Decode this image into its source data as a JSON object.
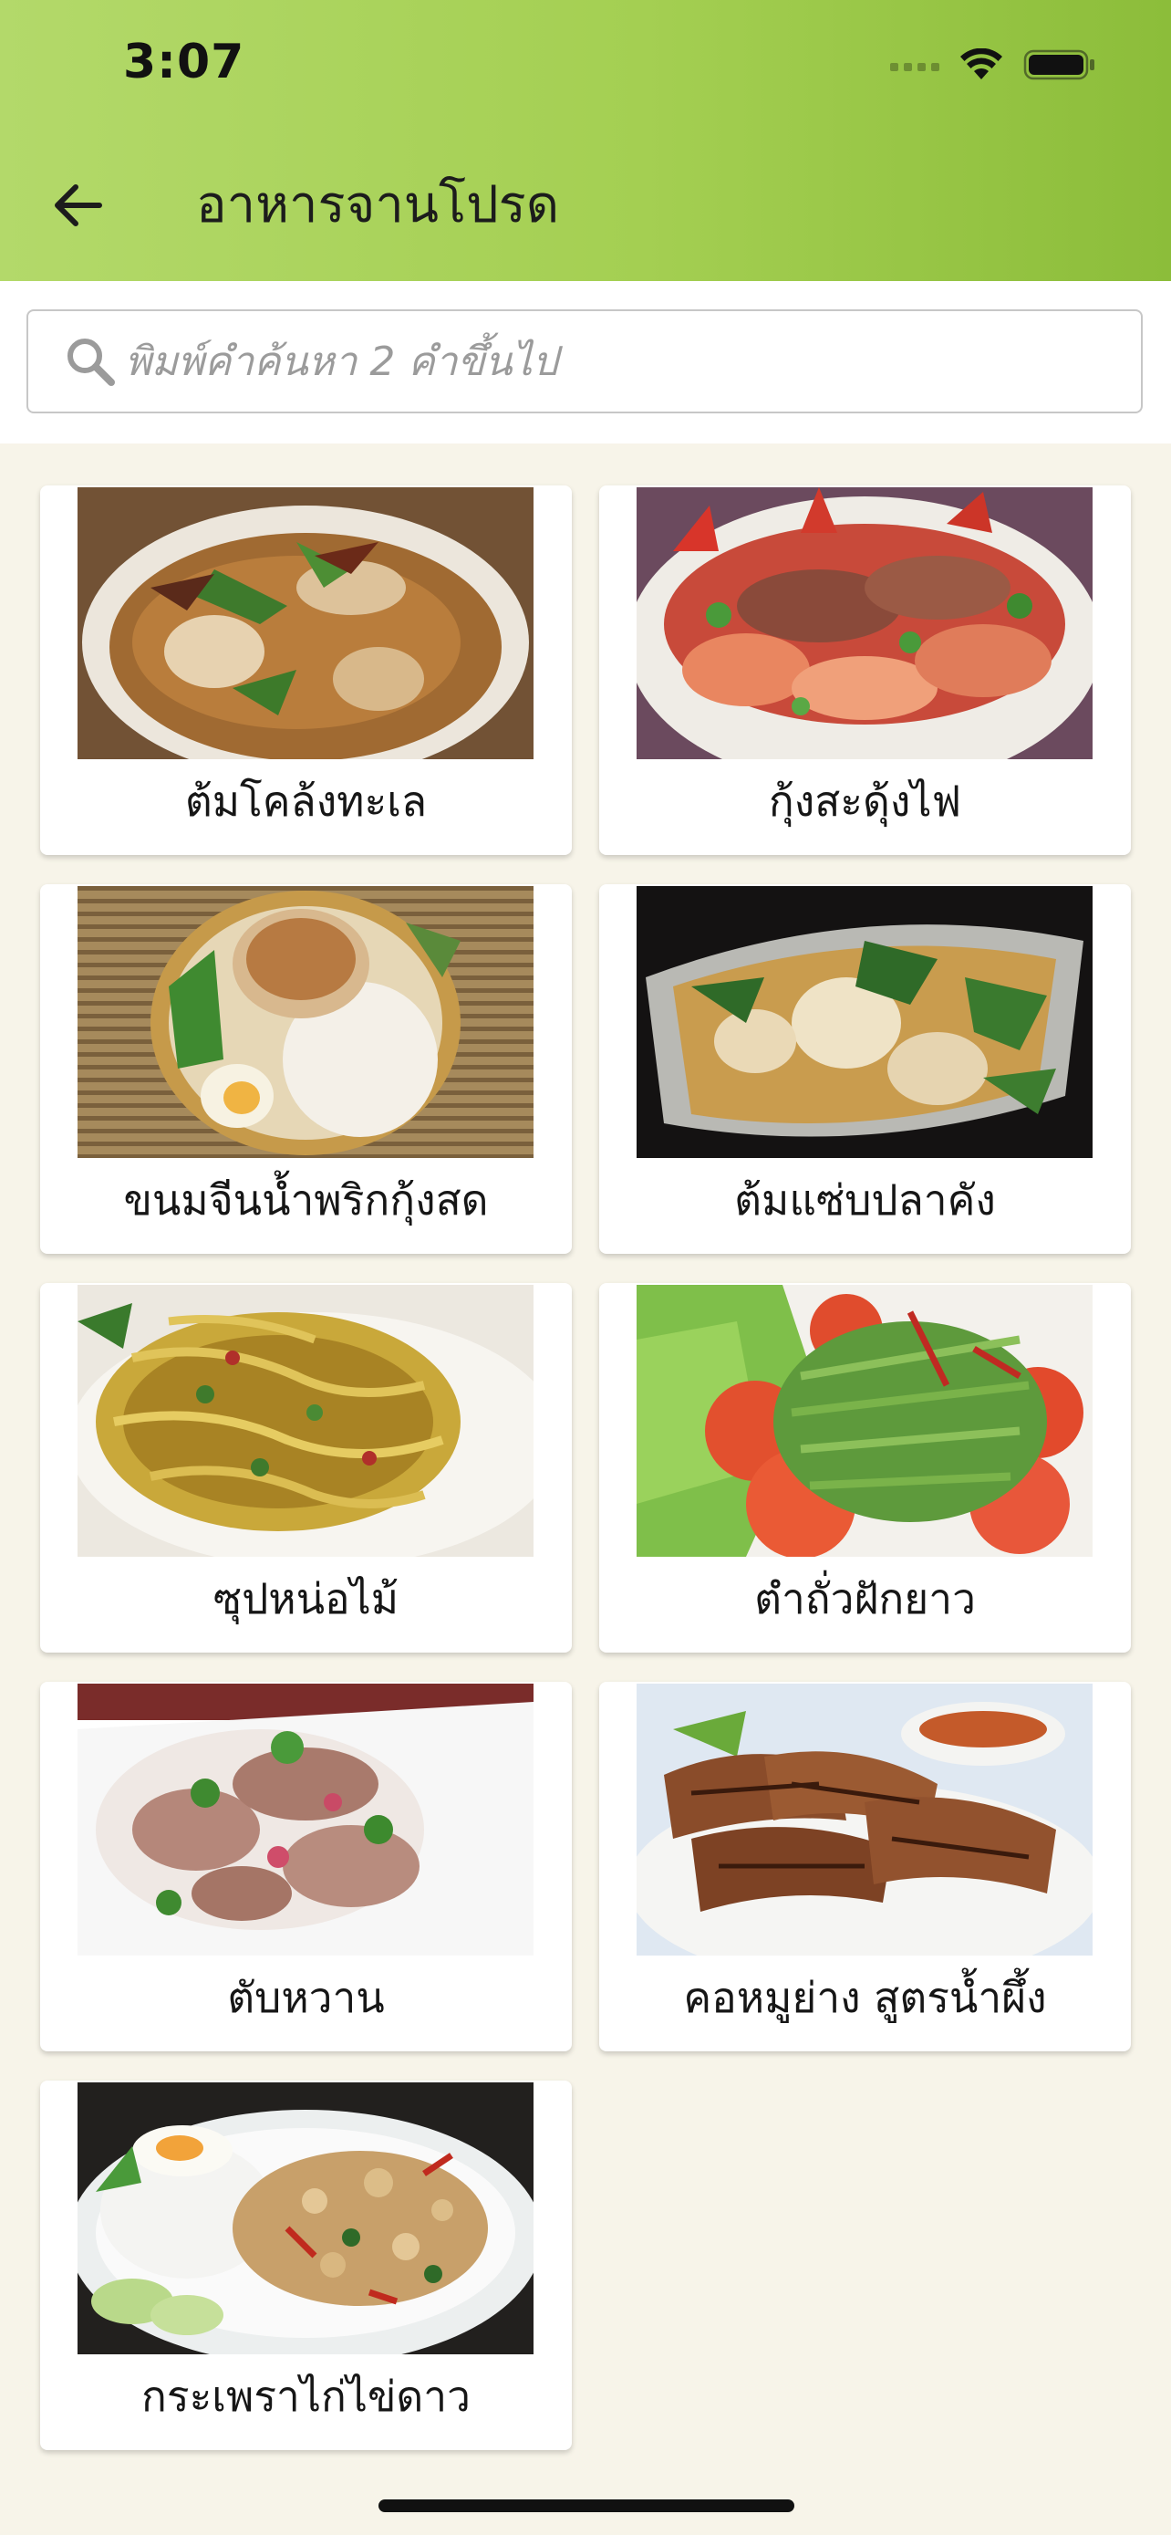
{
  "status_bar": {
    "time": "3:07"
  },
  "header": {
    "title": "อาหารจานโปรด",
    "back_icon": "arrow-left-icon"
  },
  "search": {
    "placeholder": "พิมพ์คำค้นหา 2 คำขึ้นไป",
    "icon": "search-icon"
  },
  "dishes": [
    {
      "name": "ต้มโคล้งทะเล"
    },
    {
      "name": "กุ้งสะดุ้งไฟ"
    },
    {
      "name": "ขนมจีนน้ำพริกกุ้งสด"
    },
    {
      "name": "ต้มแซ่บปลาคัง"
    },
    {
      "name": "ซุปหน่อไม้"
    },
    {
      "name": "ตำถั่วฝักยาว"
    },
    {
      "name": "ตับหวาน"
    },
    {
      "name": "คอหมูย่าง สูตรน้ำผึ้ง"
    },
    {
      "name": "กระเพราไก่ไข่ดาว"
    }
  ],
  "colors": {
    "header_start": "#b3d96a",
    "header_end": "#8cbd3a",
    "page_background": "#f7f4e9",
    "card_background": "#ffffff"
  }
}
